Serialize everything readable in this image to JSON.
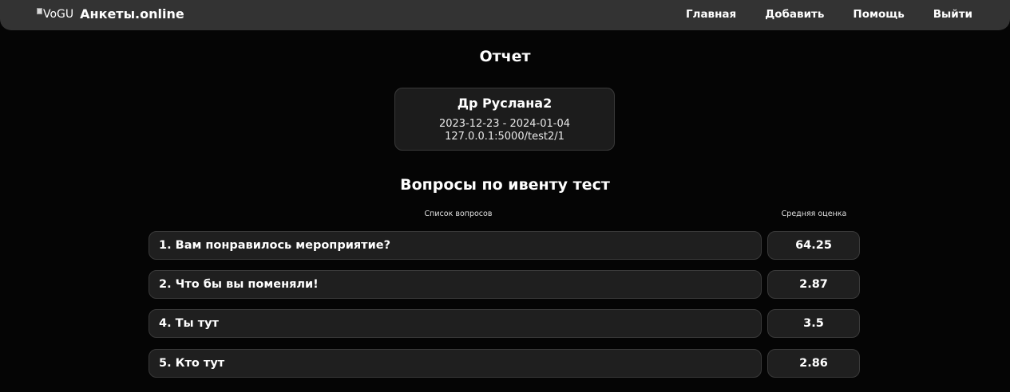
{
  "navbar": {
    "logo_alt": "VoGU",
    "brand": "Анкеты.online",
    "links": [
      "Главная",
      "Добавить",
      "Помощь",
      "Выйти"
    ]
  },
  "page": {
    "title": "Отчет"
  },
  "event_card": {
    "name": "Др Руслана2",
    "dates": "2023-12-23 - 2024-01-04",
    "url": "127.0.0.1:5000/test2/1"
  },
  "questions_section": {
    "title": "Вопросы по ивенту тест",
    "col_questions": "Список вопросов",
    "col_average": "Средняя оценка",
    "rows": [
      {
        "question": "1. Вам понравилось мероприятие?",
        "score": "64.25"
      },
      {
        "question": "2. Что бы вы поменяли!",
        "score": "2.87"
      },
      {
        "question": "4. Ты тут",
        "score": "3.5"
      },
      {
        "question": "5. Кто тут",
        "score": "2.86"
      }
    ]
  }
}
